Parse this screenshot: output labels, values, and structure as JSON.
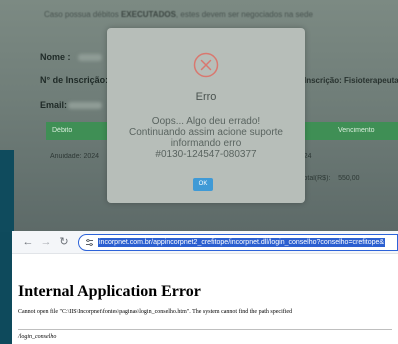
{
  "background_page": {
    "notice_prefix": "Caso possua débitos",
    "notice_bold": "EXECUTADOS",
    "notice_suffix": ", estes devem ser negociados na sede",
    "name_label": "Nome :",
    "registration_label": "N° de Inscrição:",
    "registration_right": "Inscrição: Fisioterapeuta",
    "email_label": "Email:",
    "table_header_left": "Débito",
    "table_header_right": "Vencimento",
    "row_left": "Anuidade: 2024",
    "row_right": "2024",
    "total_label": "Total(R$):",
    "total_value": "550,00"
  },
  "modal": {
    "title": "Erro",
    "line1": "Oops... Algo deu errado!",
    "line2": "Continuando assim acione suporte",
    "line3": "informando erro",
    "line4": "#0130-124547-080377",
    "ok_label": "OK"
  },
  "browser": {
    "url": "incorpnet.com.br/appincorpnet2_crefitope/incorpnet.dll/login_conselho?conselho=crefitope&",
    "error_title": "Internal Application Error",
    "error_message": "Cannot open file \"C:\\IIS\\Incorpnet\\fontes\\paginas\\login_conselho.htm\". The system cannot find the path specified",
    "path": "/login_conselho"
  },
  "colors": {
    "modal_bg": "#b7beb9",
    "ok_button": "#3f9ad6",
    "error_icon": "#d9786f",
    "green_bar": "#3f8f55",
    "url_highlight": "#2b5fd0"
  },
  "icons": {
    "modal": "error-x-circle-icon",
    "back": "arrow-left-icon",
    "forward": "arrow-right-icon",
    "reload": "reload-icon",
    "site": "site-info-icon"
  }
}
